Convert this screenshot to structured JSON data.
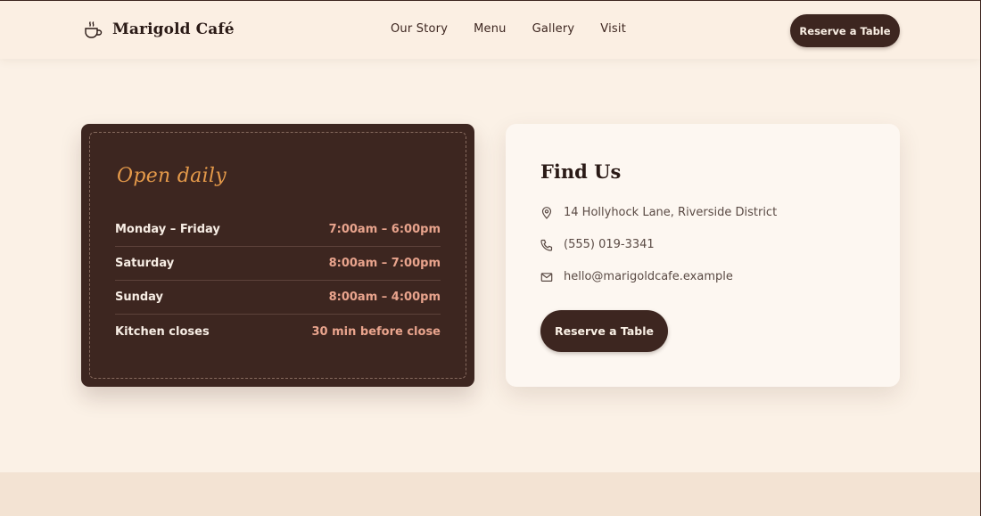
{
  "brand": {
    "name": "Marigold Café",
    "icon": "coffee-cup-icon"
  },
  "nav": {
    "items": [
      {
        "label": "Our Story"
      },
      {
        "label": "Menu"
      },
      {
        "label": "Gallery"
      },
      {
        "label": "Visit"
      }
    ],
    "cta_label": "Reserve a Table"
  },
  "hours": {
    "title": "Open daily",
    "rows": [
      {
        "day": "Monday – Friday",
        "time": "7:00am – 6:00pm"
      },
      {
        "day": "Saturday",
        "time": "8:00am – 7:00pm"
      },
      {
        "day": "Sunday",
        "time": "8:00am – 4:00pm"
      },
      {
        "day": "Kitchen closes",
        "time": "30 min before close"
      }
    ]
  },
  "find_us": {
    "title": "Find Us",
    "address": {
      "icon": "map-pin-icon",
      "text": "14 Hollyhock Lane, Riverside District"
    },
    "phone": {
      "icon": "phone-icon",
      "text": "(555) 019-3341"
    },
    "email": {
      "icon": "mail-icon",
      "text": "hello@marigoldcafe.example"
    },
    "cta_label": "Reserve a Table"
  },
  "colors": {
    "background": "#fbf1e6",
    "brand_dark": "#3d2620",
    "accent_orange": "#e59a4a",
    "accent_pink": "#e9a48d"
  }
}
